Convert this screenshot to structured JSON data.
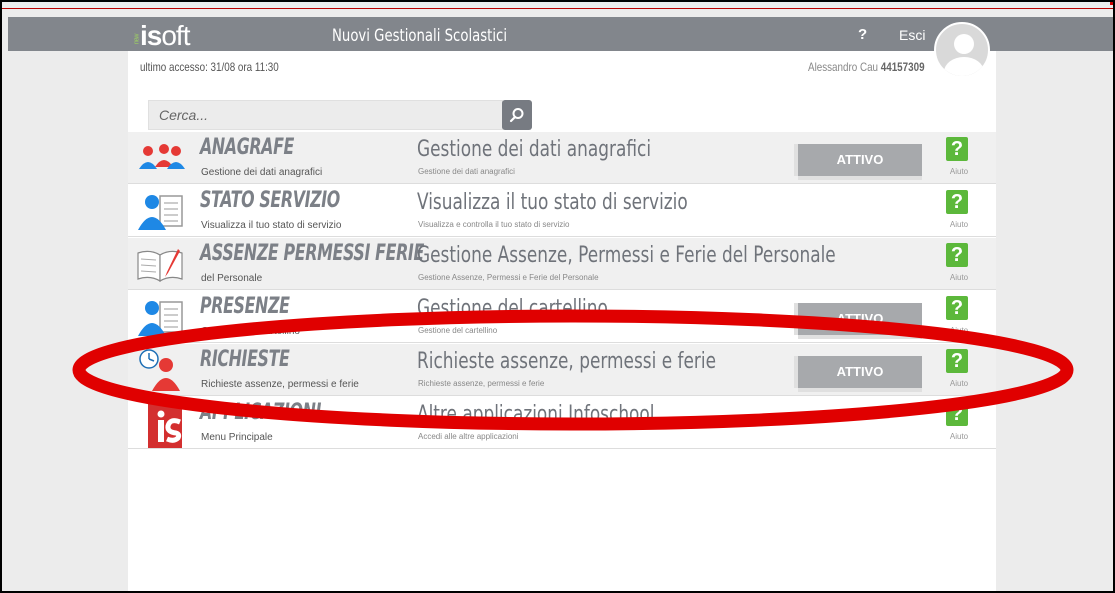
{
  "header": {
    "logo_small": "new",
    "logo_main_bold": "is",
    "logo_main_rest": "oft",
    "title": "Nuovi Gestionali Scolastici",
    "help_label": "?",
    "logout_label": "Esci"
  },
  "session": {
    "last_access": "ultimo accesso: 31/08 ora 11:30",
    "user_name": "Alessandro Cau",
    "user_code": "44157309"
  },
  "search": {
    "placeholder": "Cerca..."
  },
  "apps": [
    {
      "name": "ANAGRAFE",
      "subtitle": "Gestione dei dati anagrafici",
      "title": "Gestione dei dati anagrafici",
      "description": "Gestione dei dati anagrafici",
      "status": "ATTIVO",
      "help": "?",
      "help_label": "Aiuto",
      "icon": "people-icon"
    },
    {
      "name": "STATO SERVIZIO",
      "subtitle": "Visualizza il tuo stato di servizio",
      "title": "Visualizza il tuo stato di servizio",
      "description": "Visualizza e controlla il tuo stato di servizio",
      "status": "",
      "help": "?",
      "help_label": "Aiuto",
      "icon": "user-card-icon"
    },
    {
      "name": "ASSENZE PERMESSI FERIE",
      "subtitle": "del Personale",
      "title": "Gestione Assenze, Permessi e Ferie del Personale",
      "description": "Gestione Assenze, Permessi e Ferie del Personale",
      "status": "",
      "help": "?",
      "help_label": "Aiuto",
      "icon": "book-pen-icon"
    },
    {
      "name": "PRESENZE",
      "subtitle": "Gestione del cartellino",
      "title": "Gestione del cartellino",
      "description": "Gestione del cartellino",
      "status": "ATTIVO",
      "help": "?",
      "help_label": "Aiuto",
      "icon": "user-card-icon"
    },
    {
      "name": "RICHIESTE",
      "subtitle": "Richieste assenze, permessi e ferie",
      "title": "Richieste assenze, permessi e ferie",
      "description": "Richieste assenze, permessi e ferie",
      "status": "ATTIVO",
      "help": "?",
      "help_label": "Aiuto",
      "icon": "clock-user-icon"
    },
    {
      "name": "APPLICAZIONI",
      "subtitle": "Menu Principale",
      "title": "Altre applicazioni Infoschool",
      "description": "Accedi alle altre applicazioni",
      "status": "",
      "help": "?",
      "help_label": "Aiuto",
      "icon": "infoschool-icon"
    }
  ],
  "colors": {
    "header_bg": "#82868c",
    "highlight": "#e00000",
    "help_green": "#5cb83b",
    "status_bg": "#a7a9ac"
  }
}
